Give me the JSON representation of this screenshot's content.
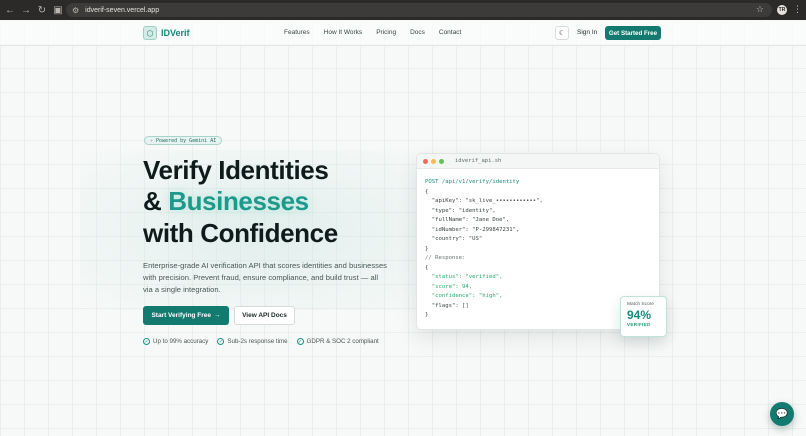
{
  "browser": {
    "url": "idverif-seven.vercel.app",
    "avatar_initials": "TR"
  },
  "header": {
    "logo_text": "IDVerif",
    "nav": [
      "Features",
      "How It Works",
      "Pricing",
      "Docs",
      "Contact"
    ],
    "sign_in": "Sign In",
    "cta": "Get Started Free"
  },
  "hero": {
    "badge": "Powered by Gemini AI",
    "title_line1": "Verify Identities",
    "title_amp": "& ",
    "title_accent": "Businesses",
    "title_line3": "with Confidence",
    "lead": "Enterprise-grade AI verification API that scores identities and businesses with precision. Prevent fraud, ensure compliance, and build trust — all via a single integration.",
    "primary_button": "Start Verifying Free",
    "secondary_button": "View API Docs",
    "features": [
      "Up to 99% accuracy",
      "Sub-2s response time",
      "GDPR & SOC 2 compliant"
    ]
  },
  "code_window": {
    "title": "idverif_api.sh",
    "request_line": "POST /api/v1/verify/identity",
    "open_brace": "{",
    "fields": [
      "\"apiKey\": \"sk_live_••••••••••••\",",
      "\"type\": \"identity\",",
      "\"fullName\": \"Jane Doe\",",
      "\"idNumber\": \"P-299847231\",",
      "\"country\": \"US\""
    ],
    "close_brace": "}",
    "response_comment": "// Response:",
    "response": [
      "\"status\": \"verified\",",
      "\"score\": 94,",
      "\"confidence\": \"high\",",
      "\"flags\": []"
    ]
  },
  "score_card": {
    "label": "Match Score",
    "value": "94%",
    "status": "VERIFIED"
  },
  "colors": {
    "brand": "#147a70",
    "accent": "#1d9a8c"
  }
}
